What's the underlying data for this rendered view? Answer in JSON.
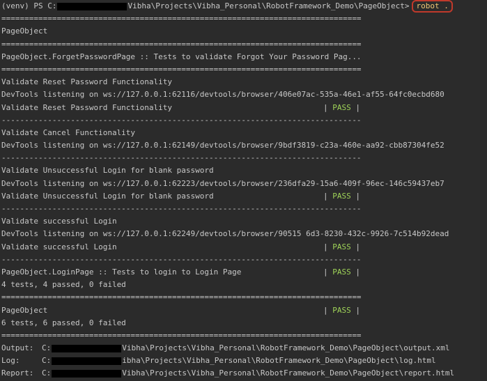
{
  "prompt": {
    "prefix": "(venv) PS C:",
    "path_tail": "Vibha\\Projects\\Vibha_Personal\\RobotFramework_Demo\\PageObject>",
    "command": "robot ."
  },
  "sep_eq": "==============================================================================",
  "sep_dash": "------------------------------------------------------------------------------",
  "suite_root": "PageObject",
  "suite_forget": "PageObject.ForgetPasswordPage :: Tests to validate Forgot Your Password Pag...",
  "tests": [
    {
      "name": "Validate Reset Password Functionality",
      "devtools": "DevTools listening on ws://127.0.0.1:62116/devtools/browser/406e07ac-535a-46e1-af55-64fc0ecbd680",
      "result_name": "Validate Reset Password Functionality",
      "status": "PASS"
    },
    {
      "name": "Validate Cancel Functionality",
      "devtools": "DevTools listening on ws://127.0.0.1:62149/devtools/browser/9bdf3819-c23a-460e-aa92-cbb87304fe52"
    },
    {
      "name": "Validate Unsuccessful Login for blank password",
      "devtools": "DevTools listening on ws://127.0.0.1:62223/devtools/browser/236dfa29-15a6-409f-96ec-146c59437eb7",
      "result_name": "Validate Unsuccessful Login for blank password",
      "status": "PASS"
    },
    {
      "name": "Validate successful Login",
      "devtools": "DevTools listening on ws://127.0.0.1:62249/devtools/browser/90515 6d3-8230-432c-9926-7c514b92dead",
      "result_name": "Validate successful Login",
      "status": "PASS"
    }
  ],
  "login_suite": {
    "name": "PageObject.LoginPage :: Tests to login to Login Page",
    "status": "PASS",
    "summary": "4 tests, 4 passed, 0 failed"
  },
  "root_result": {
    "name": "PageObject",
    "status": "PASS",
    "summary": "6 tests, 6 passed, 0 failed"
  },
  "outputs": [
    {
      "label": "Output:",
      "prefix": "C:",
      "tail": "Vibha\\Projects\\Vibha_Personal\\RobotFramework_Demo\\PageObject\\output.xml"
    },
    {
      "label": "Log:",
      "prefix": "C:",
      "tail": "ibha\\Projects\\Vibha_Personal\\RobotFramework_Demo\\PageObject\\log.html"
    },
    {
      "label": "Report:",
      "prefix": "C:",
      "tail": "Vibha\\Projects\\Vibha_Personal\\RobotFramework_Demo\\PageObject\\report.html"
    }
  ],
  "pipe": "|"
}
